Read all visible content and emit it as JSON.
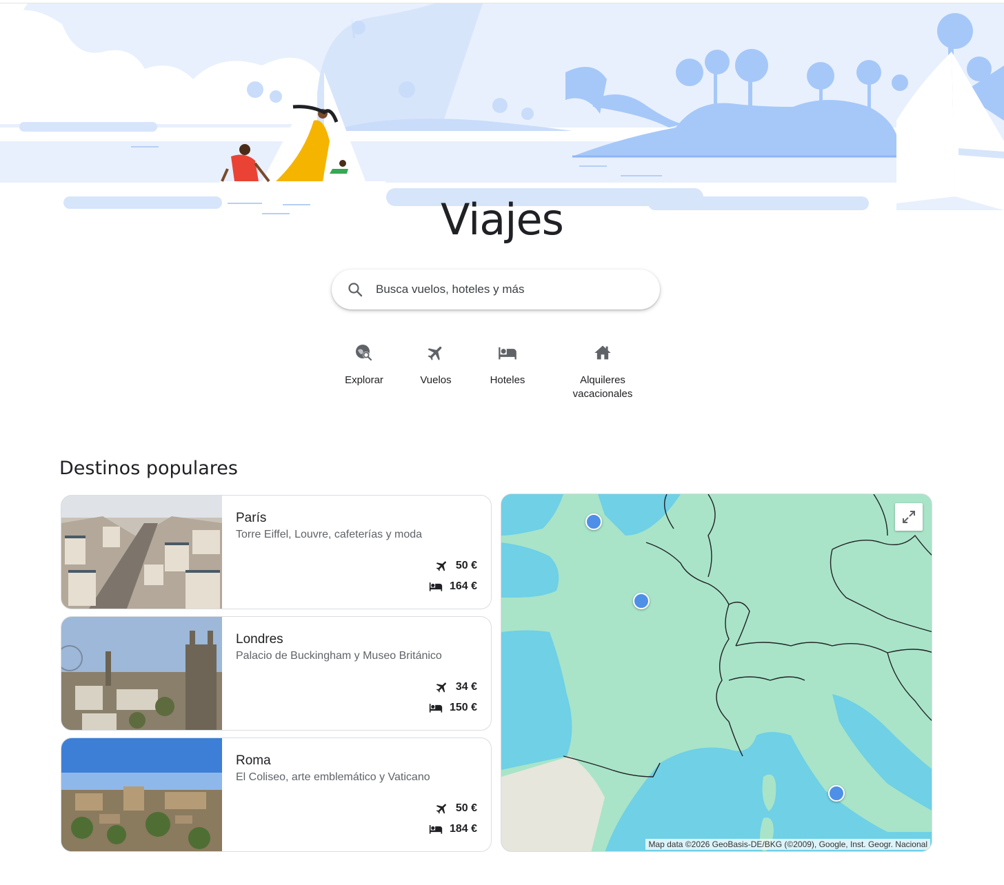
{
  "hero": {
    "title": "Viajes"
  },
  "search": {
    "placeholder": "Busca vuelos, hoteles y más",
    "icon": "search-icon"
  },
  "nav": [
    {
      "label": "Explorar",
      "icon": "explore-icon"
    },
    {
      "label": "Vuelos",
      "icon": "airplane-icon"
    },
    {
      "label": "Hoteles",
      "icon": "bed-icon"
    },
    {
      "label_line1": "Alquileres",
      "label_line2": "vacacionales",
      "icon": "house-icon"
    }
  ],
  "popular": {
    "title": "Destinos populares",
    "destinations": [
      {
        "name": "París",
        "desc": "Torre Eiffel, Louvre, cafeterías y moda",
        "flight_price": "50 €",
        "hotel_price": "164 €"
      },
      {
        "name": "Londres",
        "desc": "Palacio de Buckingham y Museo Británico",
        "flight_price": "34 €",
        "hotel_price": "150 €"
      },
      {
        "name": "Roma",
        "desc": "El Coliseo, arte emblemático y Vaticano",
        "flight_price": "50 €",
        "hotel_price": "184 €"
      }
    ]
  },
  "map": {
    "attribution": "Map data ©2026 GeoBasis-DE/BKG (©2009), Google, Inst. Geogr. Nacional",
    "expand_icon": "expand-icon",
    "pins": [
      "London",
      "Paris",
      "Rome"
    ],
    "colors": {
      "land": "#a9e4c8",
      "sea": "#6fd0e6",
      "pin": "#4e8fe8"
    }
  }
}
